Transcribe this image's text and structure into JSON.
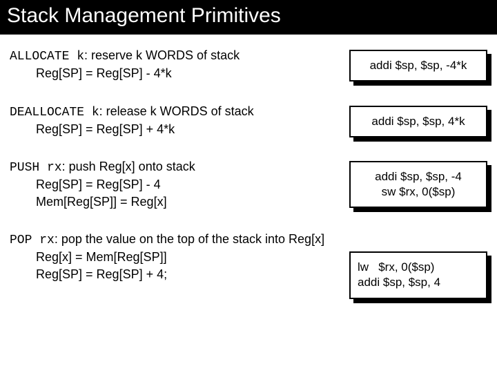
{
  "title": "Stack Management Primitives",
  "sections": [
    {
      "cmd": "ALLOCATE k",
      "desc": ": reserve k WORDS of stack",
      "ops": [
        "Reg[SP] = Reg[SP] - 4*k"
      ],
      "code": "addi $sp, $sp, -4*k",
      "align": "center"
    },
    {
      "cmd": "DEALLOCATE k",
      "desc": ": release k WORDS of stack",
      "ops": [
        "Reg[SP] = Reg[SP] + 4*k"
      ],
      "code": "addi $sp, $sp, 4*k",
      "align": "center"
    },
    {
      "cmd": "PUSH rx",
      "desc": ": push Reg[x] onto stack",
      "ops": [
        "Reg[SP] = Reg[SP] - 4",
        "Mem[Reg[SP]] = Reg[x]"
      ],
      "code": "addi $sp, $sp, -4\nsw $rx, 0($sp)",
      "align": "center"
    },
    {
      "cmd": "POP  rx",
      "desc": ": pop the value on the top of the stack into Reg[x]",
      "ops": [
        "Reg[x]  = Mem[Reg[SP]]",
        "Reg[SP] = Reg[SP] + 4;"
      ],
      "code": "lw   $rx, 0($sp)\naddi $sp, $sp, 4",
      "align": "left"
    }
  ]
}
